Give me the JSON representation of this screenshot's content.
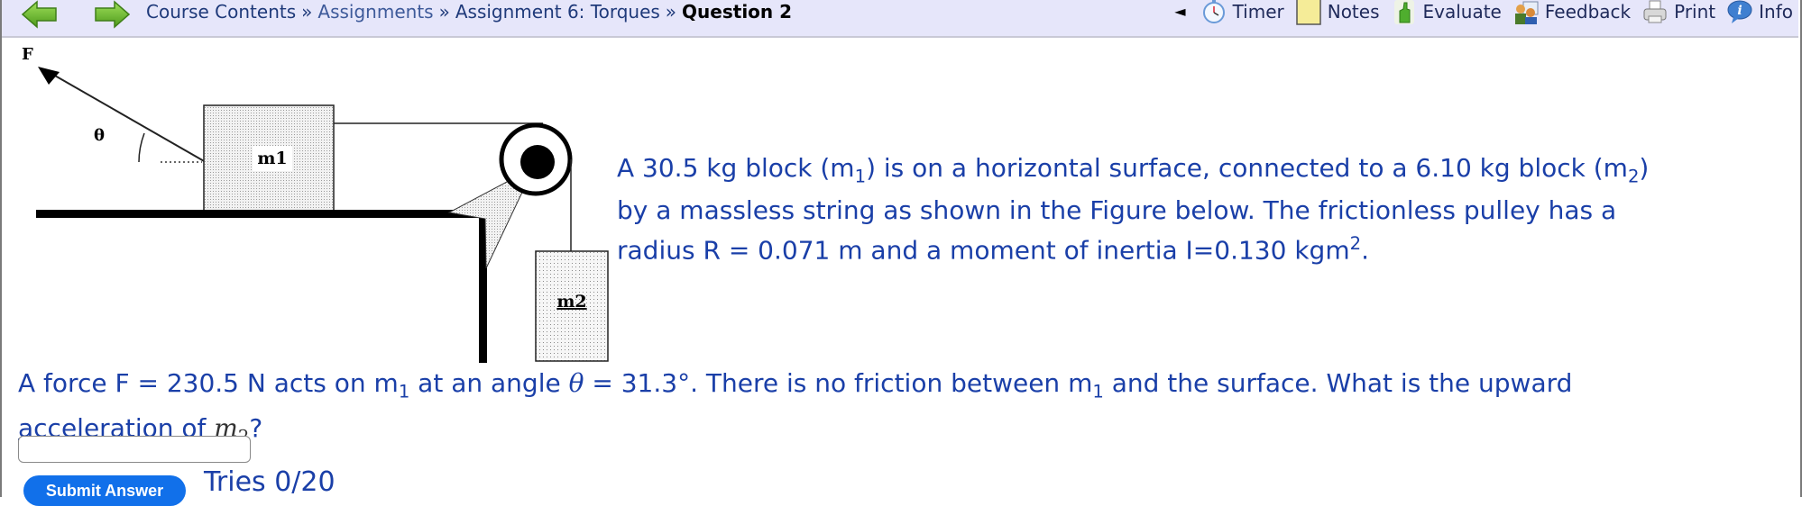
{
  "navbar": {
    "back_icon": "back-arrow-icon",
    "forward_icon": "forward-arrow-icon",
    "breadcrumb": [
      {
        "label": "Course Contents",
        "link": true
      },
      {
        "label": "Assignments",
        "link": true
      },
      {
        "label": "Assignment 6: Torques",
        "link": true
      },
      {
        "label": "Question 2",
        "link": false
      }
    ],
    "separator": "»",
    "collapse_glyph": "◄",
    "tools": [
      {
        "label": "Timer",
        "icon": "timer-icon"
      },
      {
        "label": "Notes",
        "icon": "notes-icon"
      },
      {
        "label": "Evaluate",
        "icon": "thumbs-up-icon"
      },
      {
        "label": "Feedback",
        "icon": "feedback-icon"
      },
      {
        "label": "Print",
        "icon": "printer-icon"
      },
      {
        "label": "Info",
        "icon": "info-icon"
      }
    ]
  },
  "figure": {
    "force_label": "F",
    "angle_label": "θ",
    "block1_label": "m1",
    "block2_label": "m2"
  },
  "problem": {
    "p1": "A 30.5 kg block (m",
    "p1_sub": "1",
    "p2": ") is on a horizontal surface, connected to a 6.10 kg block (m",
    "p2_sub": "2",
    "p3": ")",
    "p4": "by a massless string as shown in the Figure below. The frictionless pulley has a",
    "p5": "radius R = 0.071 m and a moment of inertia I=0.130 kgm",
    "p5_sup": "2",
    "p6": "."
  },
  "question": {
    "q1": "A force F = 230.5 N acts on m",
    "q1_sub": "1",
    "q2": " at an angle ",
    "theta": "θ",
    "q3": " = 31.3°. There is no friction between m",
    "q3_sub": "1",
    "q4": " and the surface. What is the upward",
    "q5": "acceleration of ",
    "m_var": "m",
    "m_sub": "2",
    "q6": "?"
  },
  "answer": {
    "value": "",
    "placeholder": ""
  },
  "submit": {
    "label": "Submit Answer"
  },
  "tries": {
    "text": "Tries 0/20"
  },
  "colors": {
    "text_blue": "#1a3fa8",
    "navbar_bg": "#e6e6fa",
    "submit_bg": "#1170ea"
  }
}
